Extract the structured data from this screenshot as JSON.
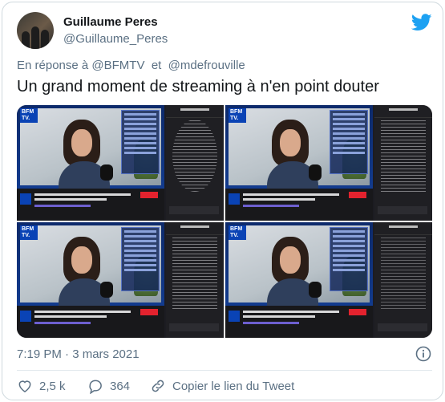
{
  "tweet": {
    "author_name": "Guillaume Peres",
    "author_handle": "@Guillaume_Peres",
    "reply_prefix": "En réponse à",
    "reply_to_1": "@BFMTV",
    "reply_joiner": "et",
    "reply_to_2": "@mdefrouville",
    "text": "Un grand moment de streaming à n'en point douter",
    "timestamp": "7:19 PM · 3 mars 2021",
    "likes": "2,5 k",
    "replies": "364",
    "copy_link_label": "Copier le lien du Tweet"
  },
  "icons": {
    "brand": "twitter-bird-icon",
    "info": "info-icon",
    "like": "heart-icon",
    "reply": "comment-icon",
    "link": "link-icon"
  },
  "colors": {
    "twitter_blue": "#1da1f2",
    "muted": "#5b7083",
    "bfm_blue": "#0a43b5"
  },
  "media": {
    "image_count": 4
  }
}
